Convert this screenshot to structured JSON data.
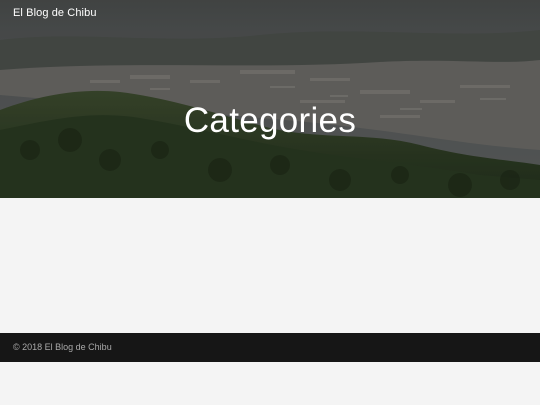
{
  "header": {
    "site_title": "El Blog de Chibu",
    "page_title": "Categories",
    "hero_image": "aerial-city-valley-photo"
  },
  "footer": {
    "copyright": "© 2018 El Blog de Chibu"
  },
  "colors": {
    "footer_bg": "#161616",
    "page_bg": "#f4f4f4",
    "title_text": "#ffffff"
  }
}
